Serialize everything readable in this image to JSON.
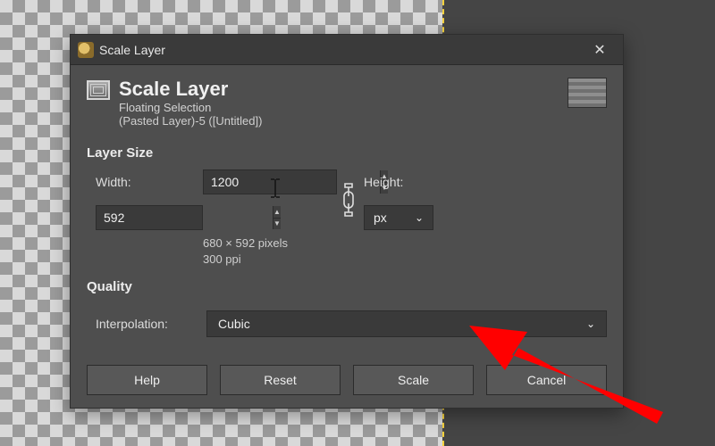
{
  "titlebar": {
    "title": "Scale Layer"
  },
  "header": {
    "title": "Scale Layer",
    "subtitle1": "Floating Selection",
    "subtitle2": "(Pasted Layer)-5 ([Untitled])"
  },
  "size": {
    "section_label": "Layer Size",
    "width_label": "Width:",
    "height_label": "Height:",
    "width_value": "1200",
    "height_value": "592",
    "unit": "px",
    "info_line1": "680 × 592 pixels",
    "info_line2": "300 ppi"
  },
  "quality": {
    "section_label": "Quality",
    "interp_label": "Interpolation:",
    "interp_value": "Cubic"
  },
  "buttons": {
    "help": "Help",
    "reset": "Reset",
    "scale": "Scale",
    "cancel": "Cancel"
  }
}
